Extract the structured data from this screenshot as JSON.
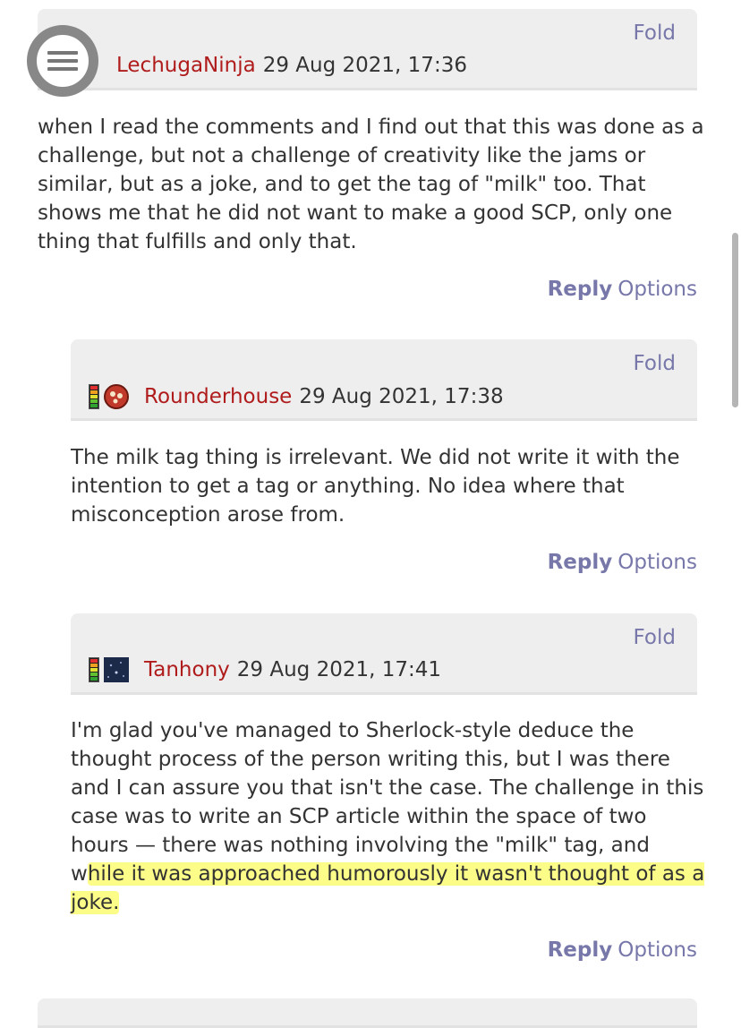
{
  "comments": [
    {
      "fold": "Fold",
      "author": "LechugaNinja",
      "timestamp": "29 Aug 2021, 17:36",
      "body": "when I read the comments and I find out that this was done as a challenge, but not a challenge of creativity like the jams or similar, but as a joke, and to get the tag of \"milk\" too. That shows me that he did not want to make a good SCP, only one thing that fulfills and only that.",
      "reply": "Reply",
      "options": "Options"
    },
    {
      "fold": "Fold",
      "author": "Rounderhouse",
      "timestamp": "29 Aug 2021, 17:38",
      "body": "The milk tag thing is irrelevant. We did not write it with the intention to get a tag or anything. No idea where that misconception arose from.",
      "reply": "Reply",
      "options": "Options"
    },
    {
      "fold": "Fold",
      "author": "Tanhony",
      "timestamp": "29 Aug 2021, 17:41",
      "body_plain": "I'm glad you've managed to Sherlock-style deduce the thought process of the person writing this, but I was there and I can assure you that isn't the case. The challenge in this case was to write an SCP article within the space of two hours — there was nothing involving the \"milk\" tag, and w",
      "body_highlight": "hile it was approached humorously it wasn't thought of as a joke.",
      "reply": "Reply",
      "options": "Options"
    }
  ],
  "colors": {
    "author": "#b01c1c",
    "link": "#7777aa",
    "header_bg": "#eeeeee",
    "highlight": "#fafa28"
  },
  "icons": {
    "menu": "hamburger-menu-icon",
    "rank": "rank-bar-icon"
  }
}
